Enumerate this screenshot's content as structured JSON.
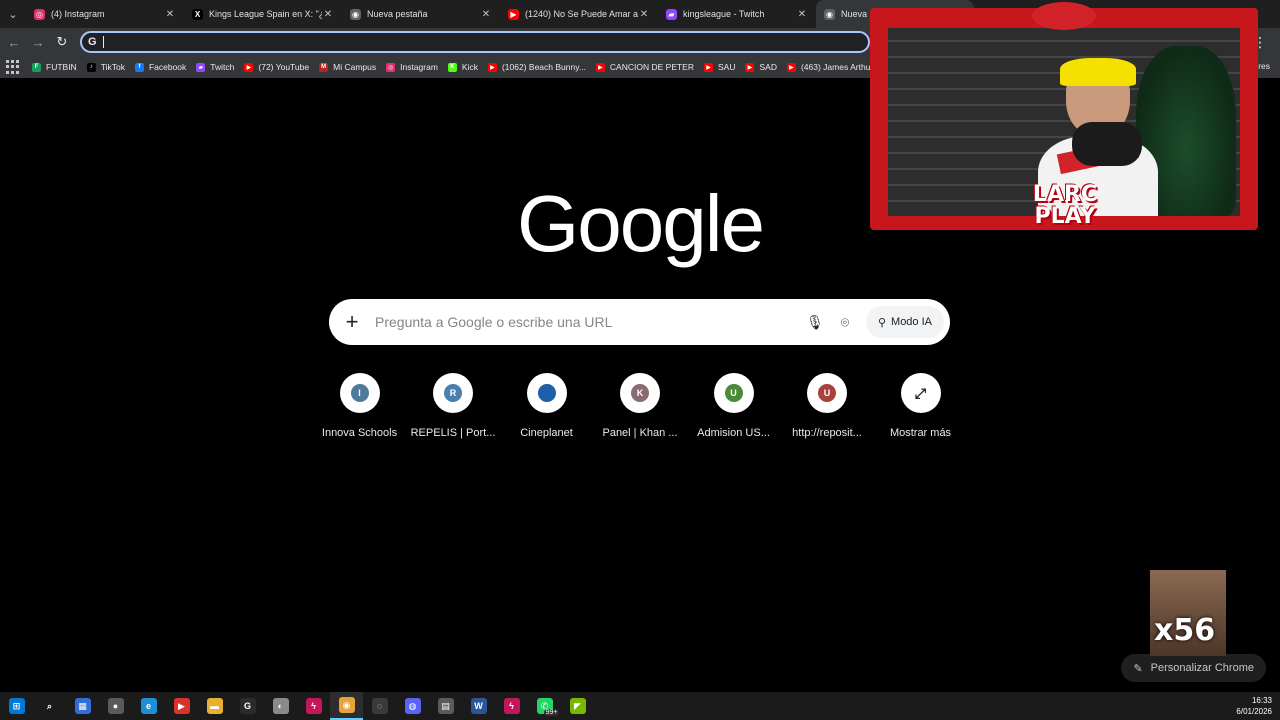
{
  "tabs": [
    {
      "title": "(4) Instagram",
      "icon": "instagram-icon",
      "color": "#e1306c",
      "glyph": "◎",
      "active": false
    },
    {
      "title": "Kings League Spain en X: \"¿Cóm",
      "icon": "x-icon",
      "color": "#000000",
      "glyph": "X",
      "active": false
    },
    {
      "title": "Nueva pestaña",
      "icon": "chrome-icon",
      "color": "#5f6368",
      "glyph": "◉",
      "active": false
    },
    {
      "title": "(1240) No Se Puede Amar a",
      "icon": "youtube-icon",
      "color": "#ff0000",
      "glyph": "▶",
      "active": false
    },
    {
      "title": "kingsleague - Twitch",
      "icon": "twitch-icon",
      "color": "#9146ff",
      "glyph": "▰",
      "active": false
    },
    {
      "title": "Nueva p",
      "icon": "chrome-icon",
      "color": "#5f6368",
      "glyph": "◉",
      "active": true
    }
  ],
  "bookmarks": [
    {
      "label": "FUTBIN",
      "icon": "futbin-icon",
      "color": "#17a05d",
      "glyph": "F"
    },
    {
      "label": "TikTok",
      "icon": "tiktok-icon",
      "color": "#000000",
      "glyph": "♪"
    },
    {
      "label": "Facebook",
      "icon": "facebook-icon",
      "color": "#1877f2",
      "glyph": "f"
    },
    {
      "label": "Twitch",
      "icon": "twitch-icon",
      "color": "#9146ff",
      "glyph": "▰"
    },
    {
      "label": "(72) YouTube",
      "icon": "youtube-icon",
      "color": "#ff0000",
      "glyph": "▶"
    },
    {
      "label": "Mi Campus",
      "icon": "campus-icon",
      "color": "#b3261e",
      "glyph": "M"
    },
    {
      "label": "Instagram",
      "icon": "instagram-icon",
      "color": "#e1306c",
      "glyph": "◎"
    },
    {
      "label": "Kick",
      "icon": "kick-icon",
      "color": "#53fc18",
      "glyph": "K"
    },
    {
      "label": "(1062) Beach Bunny...",
      "icon": "youtube-icon",
      "color": "#ff0000",
      "glyph": "▶"
    },
    {
      "label": "CANCION DE PETER",
      "icon": "youtube-icon",
      "color": "#ff0000",
      "glyph": "▶"
    },
    {
      "label": "SAU",
      "icon": "youtube-icon",
      "color": "#ff0000",
      "glyph": "▶"
    },
    {
      "label": "SAD",
      "icon": "youtube-icon",
      "color": "#ff0000",
      "glyph": "▶"
    },
    {
      "label": "(463) James Arthur -...",
      "icon": "youtube-icon",
      "color": "#ff0000",
      "glyph": "▶"
    }
  ],
  "bookmarks_other": "dores",
  "ntp": {
    "logo": "Google",
    "search_placeholder": "Pregunta a Google o escribe una URL",
    "mode_label": "Modo IA",
    "customize_label": "Personalizar Chrome"
  },
  "shortcuts": [
    {
      "label": "Innova Schools",
      "letter": "I",
      "color": "#4e7a99"
    },
    {
      "label": "REPELIS | Port...",
      "letter": "R",
      "color": "#4a7fb0"
    },
    {
      "label": "Cineplanet",
      "letter": "",
      "color": "#1d5fa8"
    },
    {
      "label": "Panel | Khan ...",
      "letter": "K",
      "color": "#8c6a72"
    },
    {
      "label": "Admision US...",
      "letter": "U",
      "color": "#4a8a3a"
    },
    {
      "label": "http://reposit...",
      "letter": "U",
      "color": "#a8423d"
    },
    {
      "label": "Mostrar más",
      "letter": "⤢",
      "color": "#ffffff"
    }
  ],
  "overlay": {
    "brand_line1": "LARC",
    "brand_line2": "PLAY",
    "reaction_count": "x56"
  },
  "taskbar": {
    "time": "16:33",
    "date": "6/01/2026",
    "apps": [
      {
        "icon": "windows-start-icon",
        "color": "#0078d4",
        "glyph": "⊞"
      },
      {
        "icon": "search-icon",
        "color": "#1b1b1b",
        "glyph": "⌕"
      },
      {
        "icon": "store-icon",
        "color": "#2f6fd6",
        "glyph": "▦"
      },
      {
        "icon": "game-icon",
        "color": "#5a5a5a",
        "glyph": "●"
      },
      {
        "icon": "edge-icon",
        "color": "#1e8fd6",
        "glyph": "e"
      },
      {
        "icon": "media-icon",
        "color": "#d9342b",
        "glyph": "▶"
      },
      {
        "icon": "file-explorer-icon",
        "color": "#e8b030",
        "glyph": "▬"
      },
      {
        "icon": "g-app-icon",
        "color": "#2b2b2b",
        "glyph": "G"
      },
      {
        "icon": "app-icon",
        "color": "#8a8a8a",
        "glyph": "◐"
      },
      {
        "icon": "bolt-icon",
        "color": "#c2185b",
        "glyph": "ϟ"
      },
      {
        "icon": "chrome-icon",
        "color": "#e8a33c",
        "glyph": "◉",
        "active": true
      },
      {
        "icon": "obs-icon",
        "color": "#3a3a3a",
        "glyph": "◌"
      },
      {
        "icon": "discord-icon",
        "color": "#5865f2",
        "glyph": "◍"
      },
      {
        "icon": "calculator-icon",
        "color": "#5b5b5b",
        "glyph": "▤"
      },
      {
        "icon": "word-icon",
        "color": "#2b579a",
        "glyph": "W"
      },
      {
        "icon": "bolt-icon",
        "color": "#c2185b",
        "glyph": "ϟ"
      },
      {
        "icon": "whatsapp-icon",
        "color": "#25d366",
        "glyph": "✆"
      },
      {
        "icon": "nvidia-icon",
        "color": "#76b900",
        "glyph": "◤"
      }
    ],
    "badge": "99+"
  }
}
